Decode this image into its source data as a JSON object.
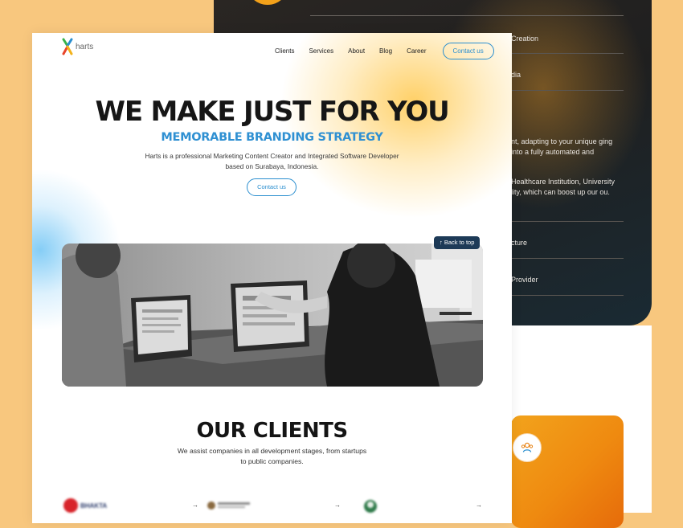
{
  "back_panel": {
    "rows": [
      "Creation",
      "dia",
      "cture",
      "Provider"
    ],
    "para1": "nt, adapting to your unique ging into a fully automated and",
    "para2": "Healthcare Institution, University lity, which can boost up our ou."
  },
  "header": {
    "logo_text": "harts",
    "nav": [
      "Clients",
      "Services",
      "About",
      "Blog",
      "Career"
    ],
    "cta": "Contact us"
  },
  "hero": {
    "title": "WE MAKE JUST FOR YOU",
    "subtitle": "MEMORABLE BRANDING STRATEGY",
    "description": "Harts is a professional Marketing Content Creator and Integrated Software Developer based on Surabaya, Indonesia.",
    "cta": "Contact us"
  },
  "back_to_top": "Back to top",
  "clients": {
    "title": "OUR CLIENTS",
    "description": "We assist companies in all development stages, from startups to public companies.",
    "logos": [
      {
        "text": "BHAKTA"
      },
      {
        "text": ""
      },
      {
        "text": ""
      }
    ],
    "arrow": "→"
  },
  "colors": {
    "accent_blue": "#2a8ecf",
    "orange": "#f2a31c",
    "background": "#f8c77e"
  },
  "icons": [
    "logo-mark-icon",
    "arrow-up-icon",
    "arrow-right-icon",
    "users-icon"
  ]
}
